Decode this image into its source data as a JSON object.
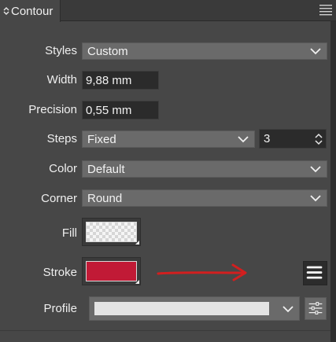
{
  "panel": {
    "tab_label": "Contour",
    "icons": {
      "collapse": "chevron-up-down-icon",
      "menu": "hamburger-menu-icon"
    }
  },
  "styles": {
    "label": "Styles",
    "value": "Custom"
  },
  "width": {
    "label": "Width",
    "value": "9,88 mm"
  },
  "precision": {
    "label": "Precision",
    "value": "0,55 mm"
  },
  "steps": {
    "label": "Steps",
    "value": "Fixed",
    "count": "3"
  },
  "color": {
    "label": "Color",
    "value": "Default"
  },
  "corner": {
    "label": "Corner",
    "value": "Round"
  },
  "fill": {
    "label": "Fill",
    "swatch": "transparent"
  },
  "stroke": {
    "label": "Stroke",
    "swatch": "#c11a36",
    "annotation_color": "#d21f1f",
    "icon": "hamburger-menu-icon"
  },
  "profile": {
    "label": "Profile",
    "icon": "sliders-settings-icon"
  }
}
